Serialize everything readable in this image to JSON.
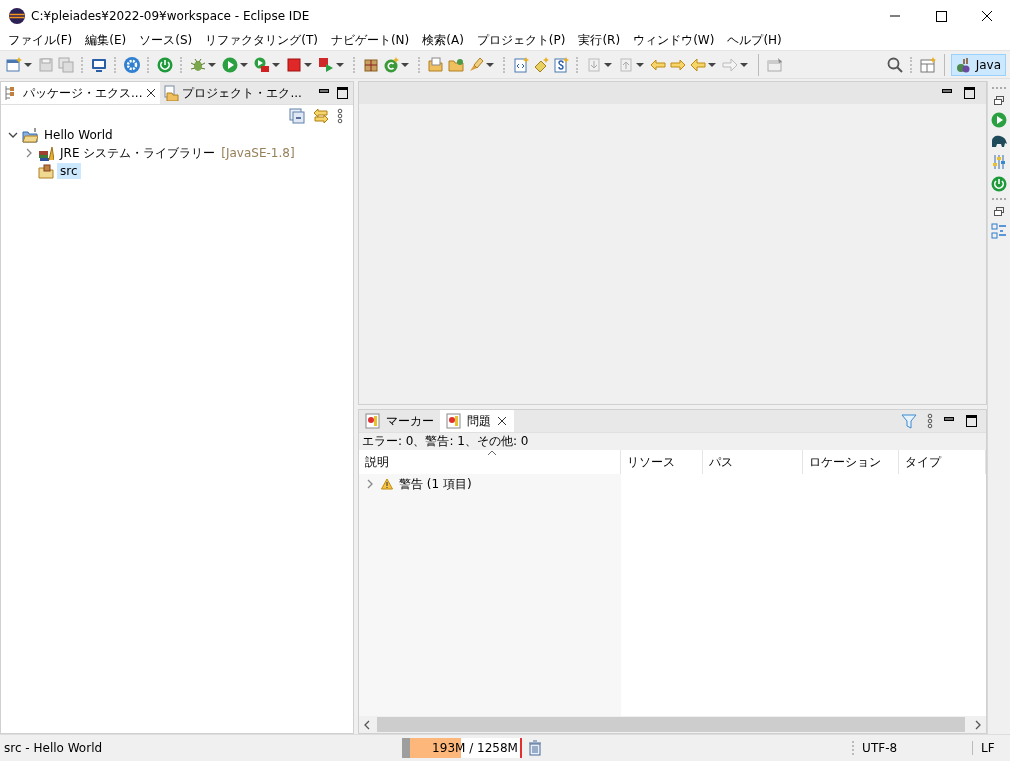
{
  "window": {
    "title": "C:¥pleiades¥2022-09¥workspace - Eclipse IDE"
  },
  "menu": [
    "ファイル(F)",
    "編集(E)",
    "ソース(S)",
    "リファクタリング(T)",
    "ナビゲート(N)",
    "検索(A)",
    "プロジェクト(P)",
    "実行(R)",
    "ウィンドウ(W)",
    "ヘルプ(H)"
  ],
  "toolbar": {
    "perspective": {
      "label": "Java",
      "selected": true
    }
  },
  "explorer": {
    "tabs": [
      {
        "label": "パッケージ・エクス...",
        "selected": true
      },
      {
        "label": "プロジェクト・エク...",
        "selected": false
      }
    ],
    "tree": [
      {
        "label": "Hello World",
        "kind": "project",
        "expanded": true,
        "selected": false,
        "children": [
          {
            "label": "JRE システム・ライブラリー",
            "decoration": "[JavaSE-1.8]",
            "kind": "library",
            "expanded": false,
            "selected": false
          },
          {
            "label": "src",
            "kind": "source-folder",
            "selected": true
          }
        ]
      }
    ]
  },
  "problems": {
    "tabs": [
      {
        "label": "マーカー",
        "selected": false
      },
      {
        "label": "問題",
        "selected": true
      }
    ],
    "summary": "エラー: 0、警告: 1、その他: 0",
    "columns": [
      "説明",
      "リソース",
      "パス",
      "ロケーション",
      "タイプ"
    ],
    "rows": [
      {
        "label": "警告 (1 項目)",
        "kind": "warning",
        "expanded": false
      }
    ]
  },
  "status_bar": {
    "selection": "src - Hello World",
    "heap": {
      "text": "193M / 1258M",
      "level": 0.46
    },
    "encoding": "UTF-8",
    "line_delimiter": "LF"
  }
}
